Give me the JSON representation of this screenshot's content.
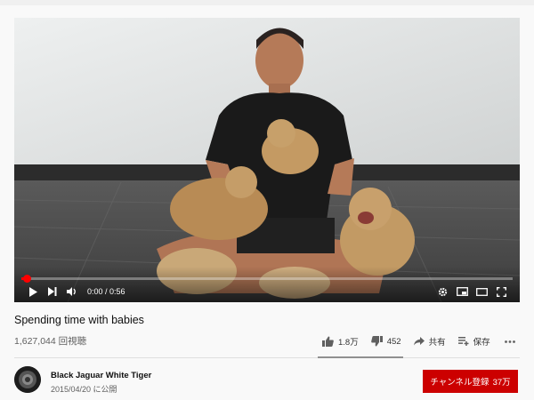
{
  "video": {
    "title": "Spending time with babies",
    "views": "1,627,044 回視聴",
    "time_current": "0:00",
    "time_sep": " / ",
    "time_total": "0:56",
    "progress": 0.01
  },
  "actions": {
    "like": "1.8万",
    "dislike": "452",
    "share": "共有",
    "save": "保存"
  },
  "channel": {
    "name": "Black Jaguar White Tiger",
    "published": "2015/04/20 に公開",
    "subscribe_label": "チャンネル登録",
    "subscriber_count": "37万"
  },
  "icons": [
    "play-icon",
    "next-icon",
    "volume-icon",
    "settings-icon",
    "miniplayer-icon",
    "theater-icon",
    "fullscreen-icon",
    "thumbs-up-icon",
    "thumbs-down-icon",
    "share-icon",
    "save-playlist-icon",
    "more-icon"
  ],
  "colors": {
    "accent": "#ff0000",
    "subscribe_bg": "#cc0000",
    "secondary_text": "#606060"
  }
}
